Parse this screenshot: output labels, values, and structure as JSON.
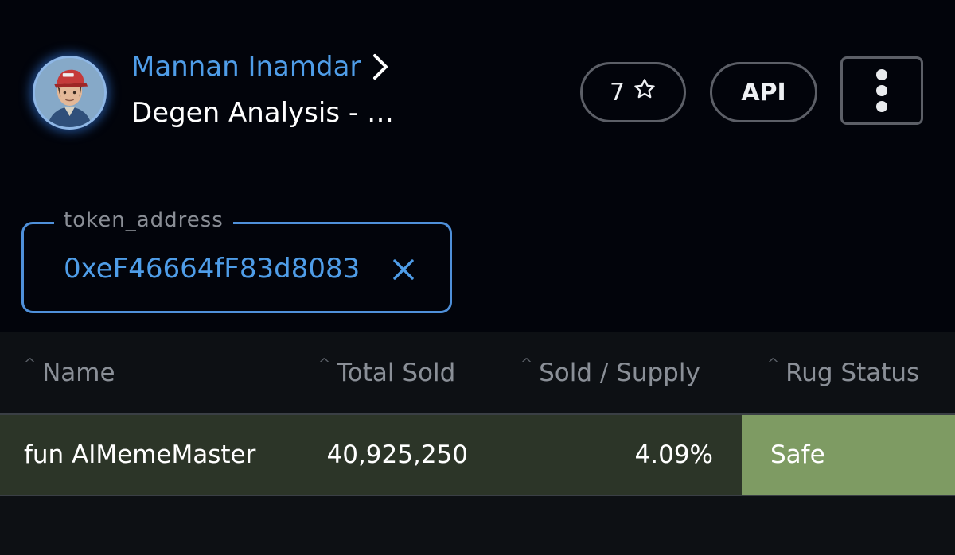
{
  "header": {
    "author_name": "Mannan Inamdar",
    "title": "Degen Analysis - Degen Token Sale Analysis",
    "stars_count": "7",
    "api_label": "API",
    "icons": {
      "author_chevron": "chevron-right-icon",
      "star": "star-icon",
      "more": "more-vertical-icon"
    }
  },
  "field": {
    "label": "token_address",
    "value": "0xeF46664fF83d8083"
  },
  "table": {
    "columns": [
      "Name",
      "Total Sold",
      "Sold / Supply",
      "Rug Status"
    ],
    "rows": [
      {
        "name": "fun AIMemeMaster",
        "total_sold": "40,925,250",
        "sold_supply": "4.09%",
        "rug_status": "Safe"
      }
    ]
  },
  "colors": {
    "background": "#02040b",
    "link": "#4f9de8",
    "row_bg": "#2c3528",
    "safe_bg": "#7e9b63",
    "field_border": "#4f90da"
  }
}
